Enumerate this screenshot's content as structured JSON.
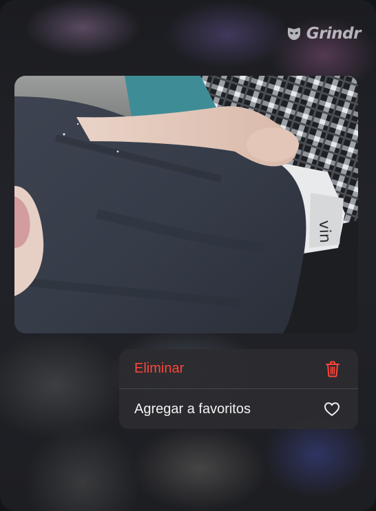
{
  "brand": {
    "name": "Grindr",
    "icon": "grindr-mask-icon"
  },
  "photo": {
    "description_icon": "photo-thumbnail"
  },
  "context_menu": {
    "items": [
      {
        "label": "Eliminar",
        "icon": "trash-icon",
        "color": "#ff453a"
      },
      {
        "label": "Agregar a favoritos",
        "icon": "heart-icon",
        "color": "#f2f2f4"
      }
    ]
  },
  "photo_text": "vin",
  "colors": {
    "destructive": "#ff453a",
    "menu_background": "#2c2c30",
    "text_primary": "#f2f2f4"
  }
}
